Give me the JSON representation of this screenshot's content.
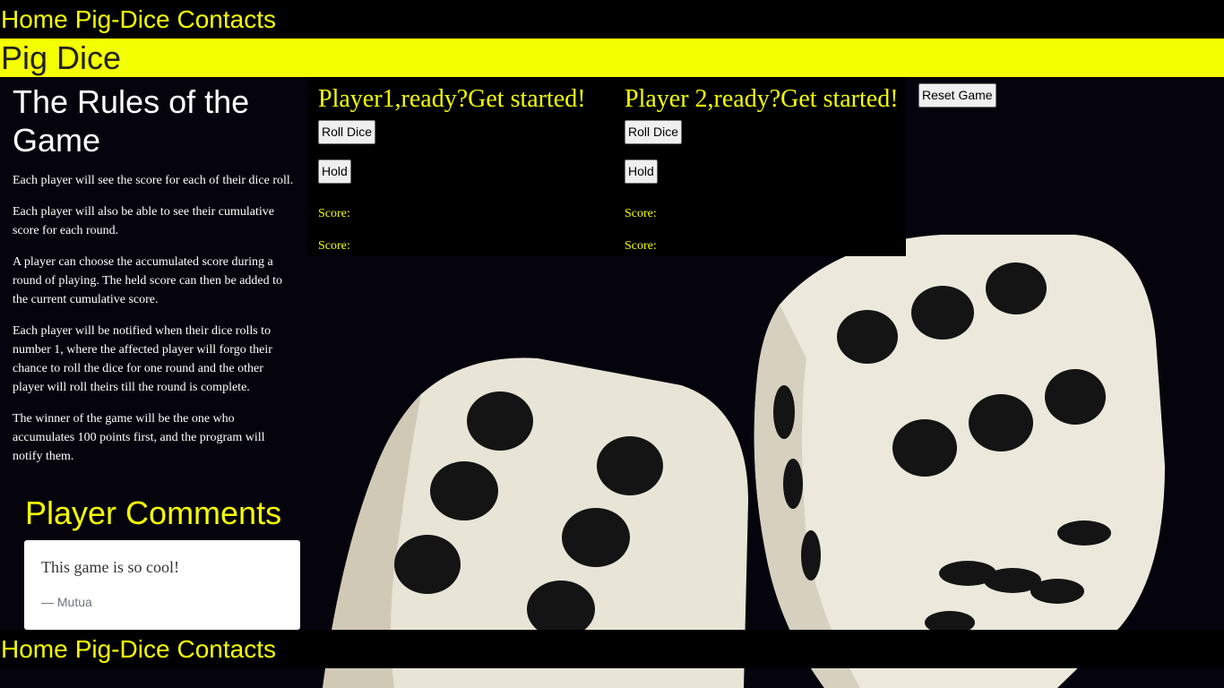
{
  "nav": {
    "items": [
      "Home",
      "Pig-Dice",
      "Contacts"
    ]
  },
  "brand": {
    "title": "Pig Dice"
  },
  "rules": {
    "heading": "The Rules of the Game",
    "paragraphs": [
      "Each player will see the score for each of their dice roll.",
      "Each player will also be able to see their cumulative score for each round.",
      "A player can choose the accumulated score during a round of playing. The held score can then be added to the current cumulative score.",
      "Each player will be notified when their dice rolls to number 1, where the affected player will forgo their chance to roll the dice for one round and the other player will roll theirs till the round is complete.",
      "The winner of the game will be the one who accumulates 100 points first, and the program will notify them."
    ]
  },
  "comments": {
    "title": "Player Comments",
    "items": [
      {
        "text": "This game is so cool!",
        "author": "— Mutua"
      }
    ]
  },
  "players": [
    {
      "heading": "Player1,ready?Get started!",
      "roll_label": "Roll Dice",
      "hold_label": "Hold",
      "score_label_1": "Score:",
      "score_label_2": "Score:"
    },
    {
      "heading": "Player 2,ready?Get started!",
      "roll_label": "Roll Dice",
      "hold_label": "Hold",
      "score_label_1": "Score:",
      "score_label_2": "Score:"
    }
  ],
  "reset_label": "Reset Game",
  "colors": {
    "accent": "#f4ff00",
    "nav_bg": "#000000",
    "panel_bg": "#000000"
  },
  "background": {
    "image": "two-white-dice-with-black-pips"
  }
}
